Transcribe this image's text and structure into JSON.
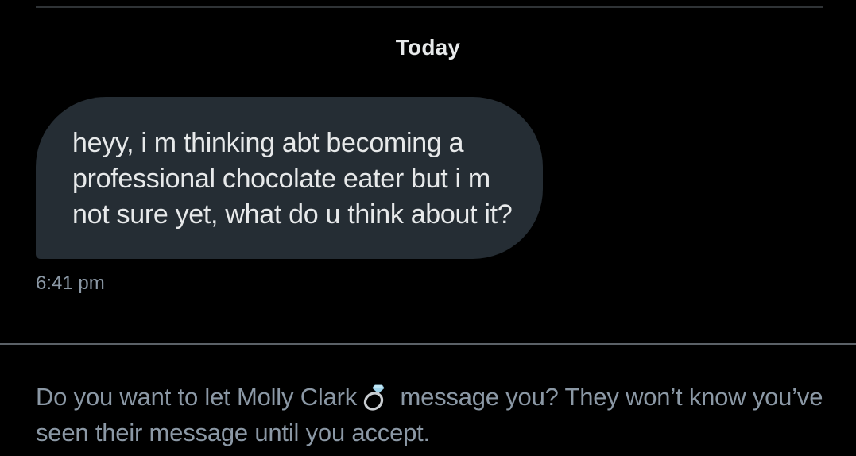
{
  "conversation": {
    "date_separator": "Today"
  },
  "message": {
    "text": "heyy, i m thinking abt becoming a professional chocolate eater but i m not sure yet, what do u think about it?",
    "time": "6:41 pm"
  },
  "request_prompt": {
    "before_name": "Do you want to let ",
    "sender_name": "Molly Clark",
    "name_emoji_icon": "ring-icon",
    "after_name": " message you? They won’t know you’ve seen their message until you accept."
  },
  "colors": {
    "background": "#000000",
    "bubble": "#252d34",
    "primary_text": "#e7e9ea",
    "secondary_text": "#8b98a5"
  }
}
